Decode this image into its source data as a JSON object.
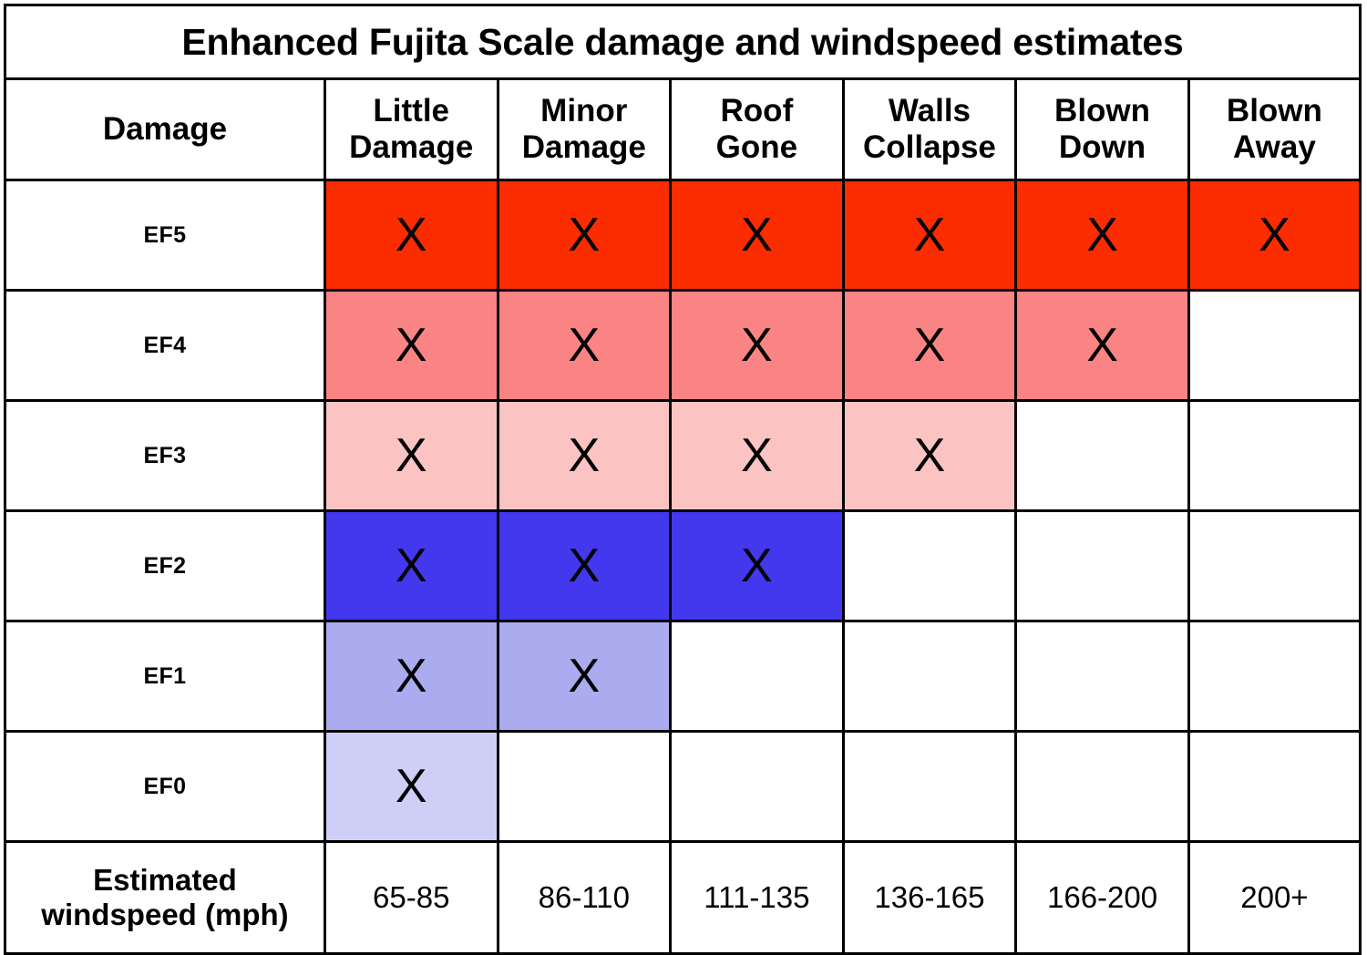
{
  "title": "Enhanced Fujita Scale damage and windspeed estimates",
  "header": {
    "corner_label": "Damage",
    "columns": [
      "Little Damage",
      "Minor Damage",
      "Roof Gone",
      "Walls Collapse",
      "Blown Down",
      "Blown Away"
    ],
    "columns_line1": [
      "Little",
      "Minor",
      "Roof",
      "Walls",
      "Blown",
      "Blown"
    ],
    "columns_line2": [
      "Damage",
      "Damage",
      "Gone",
      "Collapse",
      "Down",
      "Away"
    ]
  },
  "mark_symbol": "X",
  "rows": [
    {
      "label": "EF5",
      "filled": 6,
      "color": "#FB2C00",
      "marks": [
        "X",
        "X",
        "X",
        "X",
        "X",
        "X"
      ]
    },
    {
      "label": "EF4",
      "filled": 5,
      "color": "#FA8484",
      "marks": [
        "X",
        "X",
        "X",
        "X",
        "X",
        ""
      ]
    },
    {
      "label": "EF3",
      "filled": 4,
      "color": "#FCC3C3",
      "marks": [
        "X",
        "X",
        "X",
        "X",
        "",
        ""
      ]
    },
    {
      "label": "EF2",
      "filled": 3,
      "color": "#4338EE",
      "marks": [
        "X",
        "X",
        "X",
        "",
        "",
        ""
      ]
    },
    {
      "label": "EF1",
      "filled": 2,
      "color": "#ABABF0",
      "marks": [
        "X",
        "X",
        "",
        "",
        "",
        ""
      ]
    },
    {
      "label": "EF0",
      "filled": 1,
      "color": "#CECEF7",
      "marks": [
        "X",
        "",
        "",
        "",
        "",
        ""
      ]
    }
  ],
  "windspeed": {
    "label": "Estimated windspeed (mph)",
    "label_line1": "Estimated",
    "label_line2": "windspeed (mph)",
    "values": [
      "65-85",
      "86-110",
      "111-135",
      "136-165",
      "166-200",
      "200+"
    ]
  },
  "colors": {
    "border": "#000000",
    "background": "#FFFFFF",
    "text": "#000000",
    "ef5": "#FB2C00",
    "ef4": "#FA8484",
    "ef3": "#FCC3C3",
    "ef2": "#4338EE",
    "ef1": "#ABABF0",
    "ef0": "#CECEF7"
  }
}
